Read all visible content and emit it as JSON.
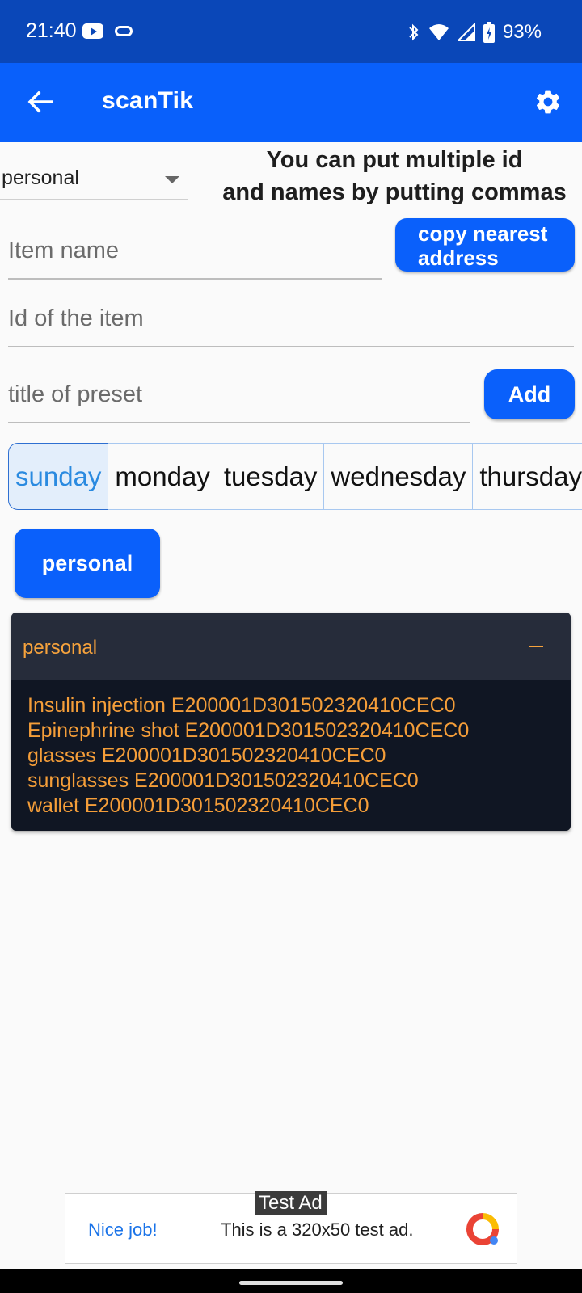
{
  "status_bar": {
    "time": "21:40",
    "battery": "93%"
  },
  "app_bar": {
    "title": "scanTik"
  },
  "dropdown": {
    "selected": "personal"
  },
  "hint": {
    "line1": "You can put multiple id",
    "line2": "and names by putting commas"
  },
  "form": {
    "item_name_placeholder": "Item name",
    "item_id_placeholder": "Id of the item",
    "preset_title_placeholder": "title of preset",
    "copy_button": {
      "line1": "copy nearest",
      "line2": "address"
    },
    "add_button": "Add"
  },
  "days": [
    "sunday",
    "monday",
    "tuesday",
    "wednesday",
    "thursday"
  ],
  "preset_button": "personal",
  "panel": {
    "title": "personal",
    "items": [
      "Insulin injection E200001D301502320410CEC0",
      "Epinephrine shot E200001D301502320410CEC0",
      "glasses E200001D301502320410CEC0",
      "sunglasses E200001D301502320410CEC0",
      "wallet E200001D301502320410CEC0"
    ]
  },
  "ad": {
    "badge": "Test Ad",
    "cta": "Nice job!",
    "text": "This is a 320x50 test ad."
  },
  "colors": {
    "status_bar": "#0a47b8",
    "app_bar": "#0960fb",
    "accent_orange": "#f59e39",
    "panel_dark": "#101623"
  }
}
